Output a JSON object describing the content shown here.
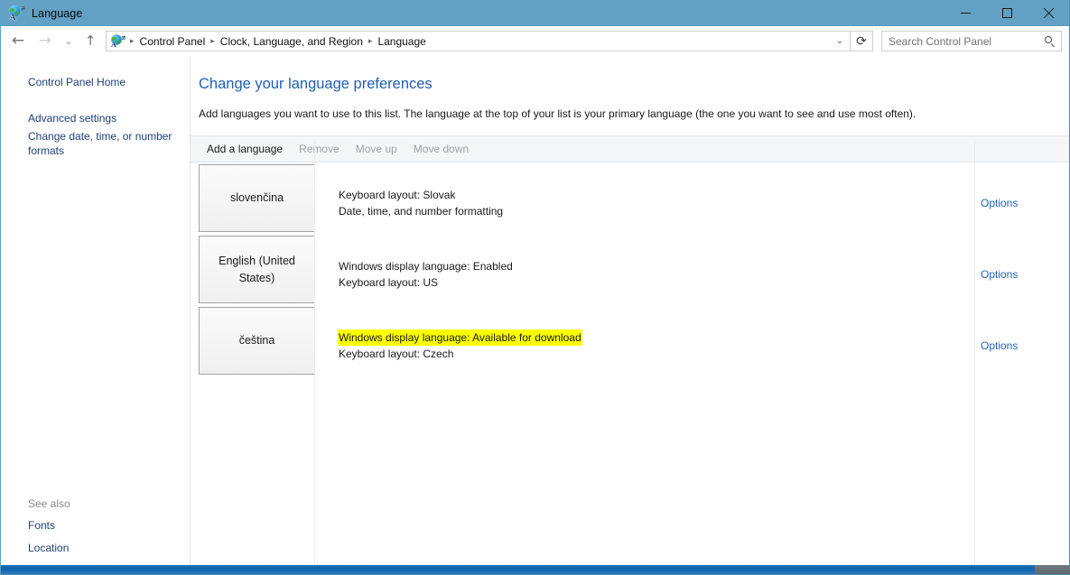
{
  "window": {
    "title": "Language",
    "icon": "language-globe-icon",
    "controls": {
      "minimize": "minimize-icon",
      "maximize": "maximize-icon",
      "close": "close-icon"
    },
    "titlebar_color": "#62a0c4"
  },
  "navbar": {
    "back": "back-arrow-icon",
    "forward": "forward-arrow-icon",
    "recent": "chevron-down-icon",
    "up": "up-arrow-icon",
    "breadcrumb": {
      "icon": "language-globe-icon",
      "separator": "▸",
      "items": [
        "Control Panel",
        "Clock, Language, and Region",
        "Language"
      ],
      "dropdown": "chevron-down-icon"
    },
    "refresh": "refresh-icon",
    "search": {
      "placeholder": "Search Control Panel",
      "value": "",
      "icon": "search-icon"
    }
  },
  "sidebar": {
    "links": [
      {
        "label": "Control Panel Home"
      },
      {
        "label": "Advanced settings"
      },
      {
        "label": "Change date, time, or number formats"
      }
    ],
    "see_also": {
      "label": "See also",
      "links": [
        {
          "label": "Fonts"
        },
        {
          "label": "Location"
        }
      ]
    }
  },
  "main": {
    "title": "Change your language preferences",
    "description": "Add languages you want to use to this list. The language at the top of your list is your primary language (the one you want to see and use most often).",
    "toolbar": [
      {
        "label": "Add a language",
        "enabled": true
      },
      {
        "label": "Remove",
        "enabled": false
      },
      {
        "label": "Move up",
        "enabled": false
      },
      {
        "label": "Move down",
        "enabled": false
      }
    ],
    "languages": [
      {
        "name": "slovenčina",
        "lines": [
          {
            "text": "Keyboard layout: Slovak",
            "highlighted": false
          },
          {
            "text": "Date, time, and number formatting",
            "highlighted": false
          }
        ],
        "options_label": "Options"
      },
      {
        "name": "English (United States)",
        "lines": [
          {
            "text": "Windows display language: Enabled",
            "highlighted": false
          },
          {
            "text": "Keyboard layout: US",
            "highlighted": false
          }
        ],
        "options_label": "Options"
      },
      {
        "name": "čeština",
        "lines": [
          {
            "text": "Windows display language: Available for download",
            "highlighted": true
          },
          {
            "text": "Keyboard layout: Czech",
            "highlighted": false
          }
        ],
        "options_label": "Options"
      }
    ]
  },
  "colors": {
    "titlebar": "#62a0c4",
    "link": "#2a62bc",
    "heading": "#1f5fb5",
    "sidebar_link": "#1f3f77",
    "highlight": "#fbff00",
    "toolbar_bg": "#f5f6f7",
    "bottom_strip": "#0f64ad"
  }
}
